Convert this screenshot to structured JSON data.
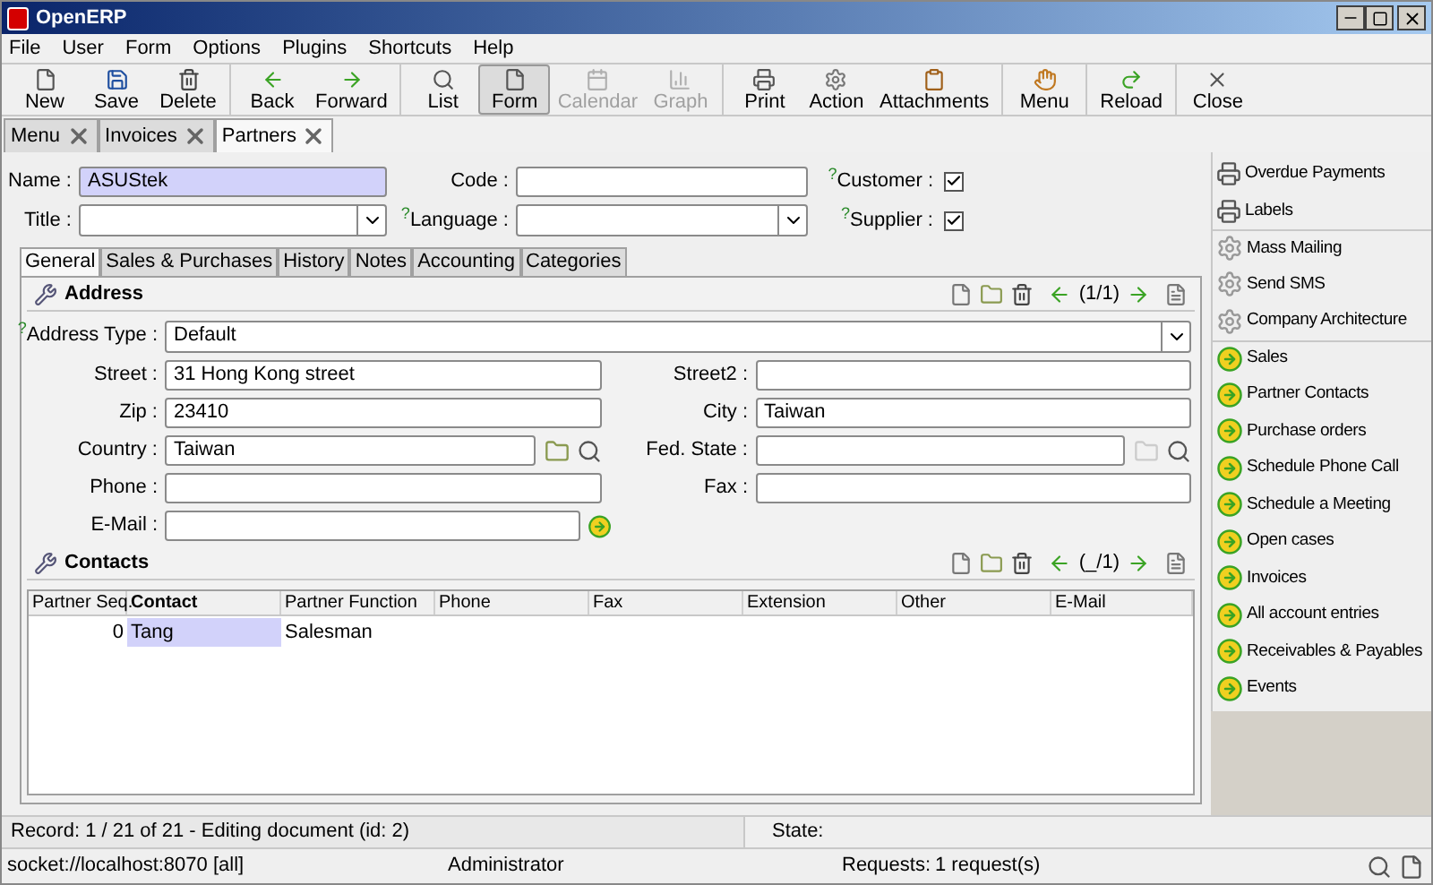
{
  "window": {
    "title": "OpenERP"
  },
  "menu": [
    "File",
    "User",
    "Form",
    "Options",
    "Plugins",
    "Shortcuts",
    "Help"
  ],
  "toolbar": [
    [
      {
        "label": "New",
        "kind": "new",
        "disabled": false,
        "selected": false
      },
      {
        "label": "Save",
        "kind": "save",
        "disabled": false,
        "selected": false
      },
      {
        "label": "Delete",
        "kind": "delete",
        "disabled": false,
        "selected": false
      }
    ],
    [
      {
        "label": "Back",
        "kind": "back",
        "disabled": false,
        "selected": false
      },
      {
        "label": "Forward",
        "kind": "forward",
        "disabled": false,
        "selected": false
      }
    ],
    [
      {
        "label": "List",
        "kind": "list",
        "disabled": false,
        "selected": false
      },
      {
        "label": "Form",
        "kind": "form",
        "disabled": false,
        "selected": true
      },
      {
        "label": "Calendar",
        "kind": "calendar",
        "disabled": true,
        "selected": false
      },
      {
        "label": "Graph",
        "kind": "graph",
        "disabled": true,
        "selected": false
      }
    ],
    [
      {
        "label": "Print",
        "kind": "print",
        "disabled": false,
        "selected": false
      },
      {
        "label": "Action",
        "kind": "action",
        "disabled": false,
        "selected": false
      },
      {
        "label": "Attachments",
        "kind": "attach",
        "disabled": false,
        "selected": false
      }
    ],
    [
      {
        "label": "Menu",
        "kind": "menu",
        "disabled": false,
        "selected": false
      }
    ],
    [
      {
        "label": "Reload",
        "kind": "reload",
        "disabled": false,
        "selected": false
      }
    ],
    [
      {
        "label": "Close",
        "kind": "close",
        "disabled": false,
        "selected": false
      }
    ]
  ],
  "tabs": [
    {
      "label": "Menu",
      "selected": false
    },
    {
      "label": "Invoices",
      "selected": false
    },
    {
      "label": "Partners",
      "selected": true
    }
  ],
  "header_fields": [
    [
      {
        "label": "Name :",
        "kind": "text",
        "value": "ASUStek",
        "required": true
      },
      {
        "label": "Code :",
        "kind": "text",
        "required": false
      },
      {
        "label": "Customer :",
        "help": "?",
        "kind": "check",
        "checked": true
      }
    ],
    [
      {
        "label": "Title :",
        "kind": "select"
      },
      {
        "label": "Language :",
        "help": "?",
        "kind": "select"
      },
      {
        "label": "Supplier :",
        "help": "?",
        "kind": "check",
        "checked": true
      }
    ]
  ],
  "notebook_tabs": [
    {
      "label": "General",
      "selected": true
    },
    {
      "label": "Sales & Purchases",
      "selected": false
    },
    {
      "label": "History",
      "selected": false
    },
    {
      "label": "Notes",
      "selected": false
    },
    {
      "label": "Accounting",
      "selected": false
    },
    {
      "label": "Categories",
      "selected": false
    }
  ],
  "address": {
    "title": "Address",
    "counter": "(1/1)",
    "type_field": {
      "label": "Address Type :",
      "help": "?",
      "value": "Default"
    },
    "rows": [
      [
        {
          "label": "Street :",
          "kind": "text",
          "value": "31 Hong Kong street"
        },
        {
          "label": "Street2 :",
          "kind": "text"
        }
      ],
      [
        {
          "label": "Zip :",
          "kind": "text",
          "value": "23410"
        },
        {
          "label": "City :",
          "kind": "text",
          "value": "Taiwan"
        }
      ],
      [
        {
          "label": "Country :",
          "kind": "search",
          "value": "Taiwan",
          "disabled": false
        },
        {
          "label": "Fed. State :",
          "kind": "search",
          "disabled": true
        }
      ],
      [
        {
          "label": "Phone :",
          "kind": "text"
        },
        {
          "label": "Fax :",
          "kind": "text"
        }
      ],
      [
        {
          "label": "E-Mail :",
          "kind": "email"
        }
      ]
    ]
  },
  "contacts": {
    "title": "Contacts",
    "counter": "(_/1)",
    "columns": [
      {
        "label": "Partner Seq.",
        "bold": false
      },
      {
        "label": "Contact",
        "bold": true
      },
      {
        "label": "Partner Function",
        "bold": false
      },
      {
        "label": "Phone",
        "bold": false
      },
      {
        "label": "Fax",
        "bold": false
      },
      {
        "label": "Extension",
        "bold": false
      },
      {
        "label": "Other",
        "bold": false
      },
      {
        "label": "E-Mail",
        "bold": false
      }
    ],
    "rows": [
      [
        "0",
        "Tang",
        "Salesman"
      ]
    ]
  },
  "sidebar": [
    {
      "label": "Overdue Payments",
      "kind": "print"
    },
    {
      "label": "Labels",
      "kind": "print"
    },
    {
      "label": "Mass Mailing",
      "kind": "action"
    },
    {
      "label": "Send SMS",
      "kind": "action"
    },
    {
      "label": "Company Architecture",
      "kind": "action"
    },
    {
      "label": "Sales",
      "kind": "link"
    },
    {
      "label": "Partner Contacts",
      "kind": "link"
    },
    {
      "label": "Purchase orders",
      "kind": "link"
    },
    {
      "label": "Schedule Phone Call",
      "kind": "link"
    },
    {
      "label": "Schedule a Meeting",
      "kind": "link"
    },
    {
      "label": "Open cases",
      "kind": "link"
    },
    {
      "label": "Invoices",
      "kind": "link"
    },
    {
      "label": "All account entries",
      "kind": "link"
    },
    {
      "label": "Receivables & Payables",
      "kind": "link"
    },
    {
      "label": "Events",
      "kind": "link"
    }
  ],
  "status": {
    "record": "Record: 1 / 21 of 21 - Editing document (id: 2)",
    "state_label": "State:"
  },
  "bottom_bar": {
    "server": "socket://localhost:8070 [all]",
    "user": "Administrator",
    "requests_label": "Requests:",
    "requests": "1 request(s)"
  }
}
